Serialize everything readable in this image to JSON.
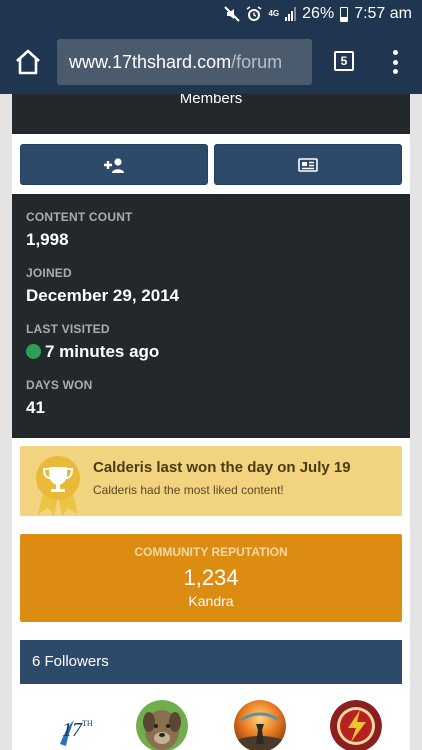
{
  "status_bar": {
    "network_label": "4G",
    "battery": "26%",
    "time": "7:57 am"
  },
  "browser": {
    "url_domain": "www.17thshard.com",
    "url_path": "/forum",
    "tab_count": "5"
  },
  "profile": {
    "members_label": "Members",
    "stats": [
      {
        "label": "CONTENT COUNT",
        "value": "1,998"
      },
      {
        "label": "JOINED",
        "value": "December 29, 2014"
      },
      {
        "label": "LAST VISITED",
        "value": "7 minutes ago"
      },
      {
        "label": "DAYS WON",
        "value": "41"
      }
    ],
    "day_won": {
      "title": "Calderis last won the day on July 19",
      "subtitle": "Calderis had the most liked content!"
    },
    "reputation": {
      "label": "COMMUNITY REPUTATION",
      "value": "1,234",
      "title": "Kandra"
    },
    "followers": {
      "heading": "6 Followers",
      "logo_text": "17",
      "logo_sup": "TH"
    }
  },
  "colors": {
    "header": "#1f3550",
    "button": "#2e4a6b",
    "dark_card": "#23282d",
    "day_won_bg": "#f2d37f",
    "reputation_bg": "#dd8c12",
    "online": "#2f9e57"
  }
}
